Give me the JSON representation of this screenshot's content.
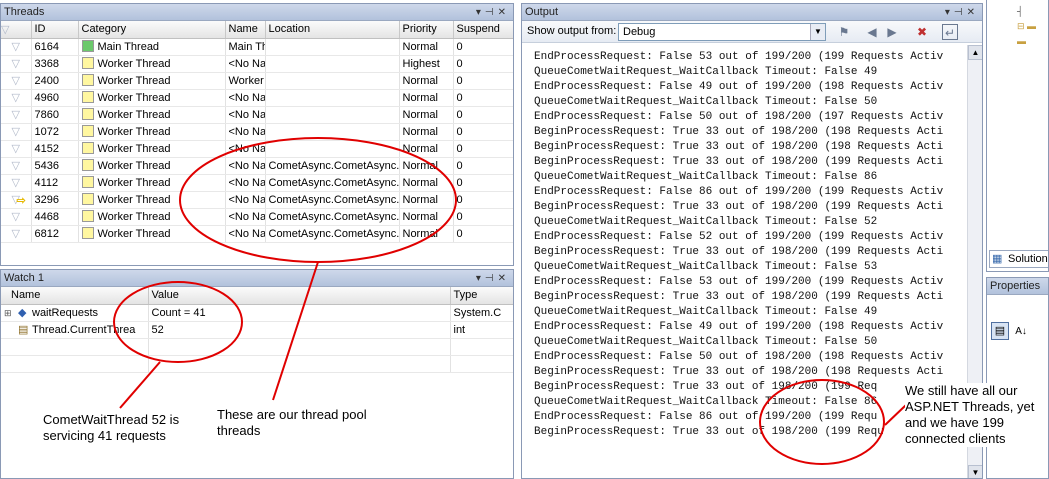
{
  "threads": {
    "title": "Threads",
    "columns": [
      "",
      "ID",
      "Category",
      "Name",
      "Location",
      "Priority",
      "Suspend"
    ],
    "rows": [
      {
        "id": "6164",
        "category": "Main Thread",
        "kind": "main",
        "name": "Main Th",
        "location": "",
        "priority": "Normal",
        "suspend": "0",
        "current": false
      },
      {
        "id": "3368",
        "category": "Worker Thread",
        "kind": "worker",
        "name": "<No Na",
        "location": "",
        "priority": "Highest",
        "suspend": "0",
        "current": false
      },
      {
        "id": "2400",
        "category": "Worker Thread",
        "kind": "worker",
        "name": "Worker",
        "location": "",
        "priority": "Normal",
        "suspend": "0",
        "current": false
      },
      {
        "id": "4960",
        "category": "Worker Thread",
        "kind": "worker",
        "name": "<No Na",
        "location": "",
        "priority": "Normal",
        "suspend": "0",
        "current": false
      },
      {
        "id": "7860",
        "category": "Worker Thread",
        "kind": "worker",
        "name": "<No Na",
        "location": "",
        "priority": "Normal",
        "suspend": "0",
        "current": false
      },
      {
        "id": "1072",
        "category": "Worker Thread",
        "kind": "worker",
        "name": "<No Na",
        "location": "",
        "priority": "Normal",
        "suspend": "0",
        "current": false
      },
      {
        "id": "4152",
        "category": "Worker Thread",
        "kind": "worker",
        "name": "<No Na",
        "location": "",
        "priority": "Normal",
        "suspend": "0",
        "current": false
      },
      {
        "id": "5436",
        "category": "Worker Thread",
        "kind": "worker",
        "name": "<No Na",
        "location": "CometAsync.CometAsync.(",
        "priority": "Normal",
        "suspend": "0",
        "current": false
      },
      {
        "id": "4112",
        "category": "Worker Thread",
        "kind": "worker",
        "name": "<No Na",
        "location": "CometAsync.CometAsync.(",
        "priority": "Normal",
        "suspend": "0",
        "current": false
      },
      {
        "id": "3296",
        "category": "Worker Thread",
        "kind": "worker",
        "name": "<No Na",
        "location": "CometAsync.CometAsync.(",
        "priority": "Normal",
        "suspend": "0",
        "current": true
      },
      {
        "id": "4468",
        "category": "Worker Thread",
        "kind": "worker",
        "name": "<No Na",
        "location": "CometAsync.CometAsync.(",
        "priority": "Normal",
        "suspend": "0",
        "current": false
      },
      {
        "id": "6812",
        "category": "Worker Thread",
        "kind": "worker",
        "name": "<No Na",
        "location": "CometAsync.CometAsync.(",
        "priority": "Normal",
        "suspend": "0",
        "current": false
      }
    ]
  },
  "watch": {
    "title": "Watch 1",
    "columns": [
      "Name",
      "Value",
      "Type"
    ],
    "rows": [
      {
        "name": "waitRequests",
        "value": "Count = 41",
        "type": "System.C",
        "expandable": true
      },
      {
        "name": "Thread.CurrentThrea",
        "value": "52",
        "type": "int",
        "expandable": false
      }
    ]
  },
  "output": {
    "title": "Output",
    "show_from_label": "Show output from:",
    "source": "Debug",
    "lines": [
      "EndProcessRequest: False 53 out of 199/200 (199 Requests Activ",
      "QueueCometWaitRequest_WaitCallback Timeout: False 49",
      "EndProcessRequest: False 49 out of 199/200 (198 Requests Activ",
      "QueueCometWaitRequest_WaitCallback Timeout: False 50",
      "EndProcessRequest: False 50 out of 198/200 (197 Requests Activ",
      "BeginProcessRequest: True 33 out of 198/200 (198 Requests Acti",
      "BeginProcessRequest: True 33 out of 198/200 (198 Requests Acti",
      "BeginProcessRequest: True 33 out of 198/200 (199 Requests Acti",
      "QueueCometWaitRequest_WaitCallback Timeout: False 86",
      "EndProcessRequest: False 86 out of 199/200 (199 Requests Activ",
      "BeginProcessRequest: True 33 out of 198/200 (199 Requests Acti",
      "QueueCometWaitRequest_WaitCallback Timeout: False 52",
      "EndProcessRequest: False 52 out of 199/200 (199 Requests Activ",
      "BeginProcessRequest: True 33 out of 198/200 (199 Requests Acti",
      "QueueCometWaitRequest_WaitCallback Timeout: False 53",
      "EndProcessRequest: False 53 out of 199/200 (199 Requests Activ",
      "BeginProcessRequest: True 33 out of 198/200 (199 Requests Acti",
      "QueueCometWaitRequest_WaitCallback Timeout: False 49",
      "EndProcessRequest: False 49 out of 199/200 (198 Requests Activ",
      "QueueCometWaitRequest_WaitCallback Timeout: False 50",
      "EndProcessRequest: False 50 out of 198/200 (198 Requests Activ",
      "BeginProcessRequest: True 33 out of 198/200 (198 Requests Acti",
      "BeginProcessRequest: True 33 out of 198/200 (199 Req",
      "QueueCometWaitRequest_WaitCallback Timeout: False 86",
      "EndProcessRequest: False 86 out of 199/200 (199 Requ",
      "BeginProcessRequest: True 33 out of 198/200 (199 Requ"
    ]
  },
  "right_panels": {
    "solution_tab": "Solution",
    "properties_title": "Properties"
  },
  "annotations": {
    "comet": "CometWaitThread 52 is servicing 41 requests",
    "pool": "These are our thread pool threads",
    "aspnet": "We still have all our ASP.NET Threads, yet and we have 199 connected clients"
  },
  "colors": {
    "annotation_red": "#e00000",
    "titlebar": "#c3cfe4",
    "main_thread": "#6cc96c",
    "worker_thread": "#fff7a0"
  }
}
